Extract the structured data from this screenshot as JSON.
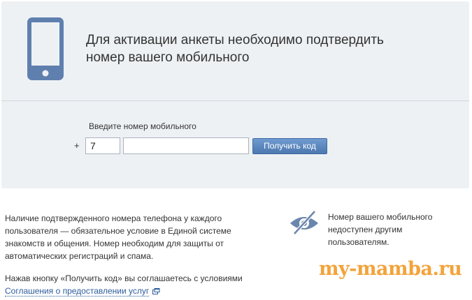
{
  "panel": {
    "title": "Для активации анкеты необходимо подтвердить номер вашего мобильного"
  },
  "form": {
    "label": "Введите номер мобильного",
    "plus": "+",
    "country_code_value": "7",
    "phone_value": "",
    "button_label": "Получить код"
  },
  "info": {
    "text": "Наличие подтвержденного номера телефона у каждого пользователя — обязательное условие в Единой системе знакомств и общения. Номер необходим для защиты от автоматических регистраций и спама.",
    "agreement_prefix": "Нажав кнопку «Получить код» вы соглашаетесь с условиями",
    "agreement_link": "Соглашения о предоставлении услуг"
  },
  "privacy": {
    "text": "Номер вашего мобильного недоступен другим пользователям."
  },
  "watermark": "my-mamba.ru",
  "colors": {
    "panel_bg": "#eef1f4",
    "accent_blue": "#5c84bb",
    "link": "#2b5c9b",
    "watermark": "#f3a33a"
  },
  "icons": [
    "phone-icon",
    "eye-hidden-icon",
    "external-link-icon"
  ]
}
